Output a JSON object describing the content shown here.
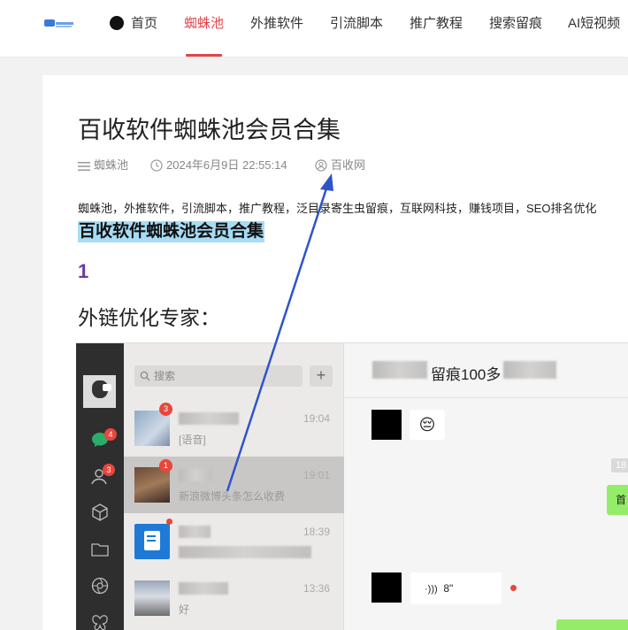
{
  "nav": {
    "items": [
      {
        "label": "首页",
        "active": false
      },
      {
        "label": "蜘蛛池",
        "active": true
      },
      {
        "label": "外推软件",
        "active": false
      },
      {
        "label": "引流脚本",
        "active": false
      },
      {
        "label": "推广教程",
        "active": false
      },
      {
        "label": "搜索留痕",
        "active": false
      },
      {
        "label": "AI短视频",
        "active": false
      }
    ],
    "accent": "#e0454b"
  },
  "article": {
    "title": "百收软件蜘蛛池会员合集",
    "meta": {
      "category": "蜘蛛池",
      "datetime": "2024年6月9日 22:55:14",
      "author": "百收网"
    },
    "tags_line": "蜘蛛池，外推软件，引流脚本，推广教程，泛目录寄生虫留痕，互联网科技，赚钱项目，SEO排名优化",
    "highlight_title": "百收软件蜘蛛池会员合集",
    "section_number": "1",
    "section_heading": "外链优化专家："
  },
  "chat_app": {
    "search_placeholder": "搜索",
    "plus_label": "+",
    "rail_badges": {
      "chat": "4",
      "contacts": "3"
    },
    "conversations": [
      {
        "badge": "3",
        "time": "19:04",
        "message": "[语音]",
        "selected": false
      },
      {
        "badge": "1",
        "time": "19:01",
        "message": "新浪微博头条怎么收费",
        "selected": true
      },
      {
        "badge": "",
        "time": "18:39",
        "message": "",
        "selected": false
      },
      {
        "badge": "",
        "time": "13:36",
        "message": "好",
        "selected": false
      }
    ],
    "chat_title": "留痕100多",
    "time_chip": "18",
    "green_text": "首",
    "emoji": "😔",
    "voice_duration": "8\""
  }
}
